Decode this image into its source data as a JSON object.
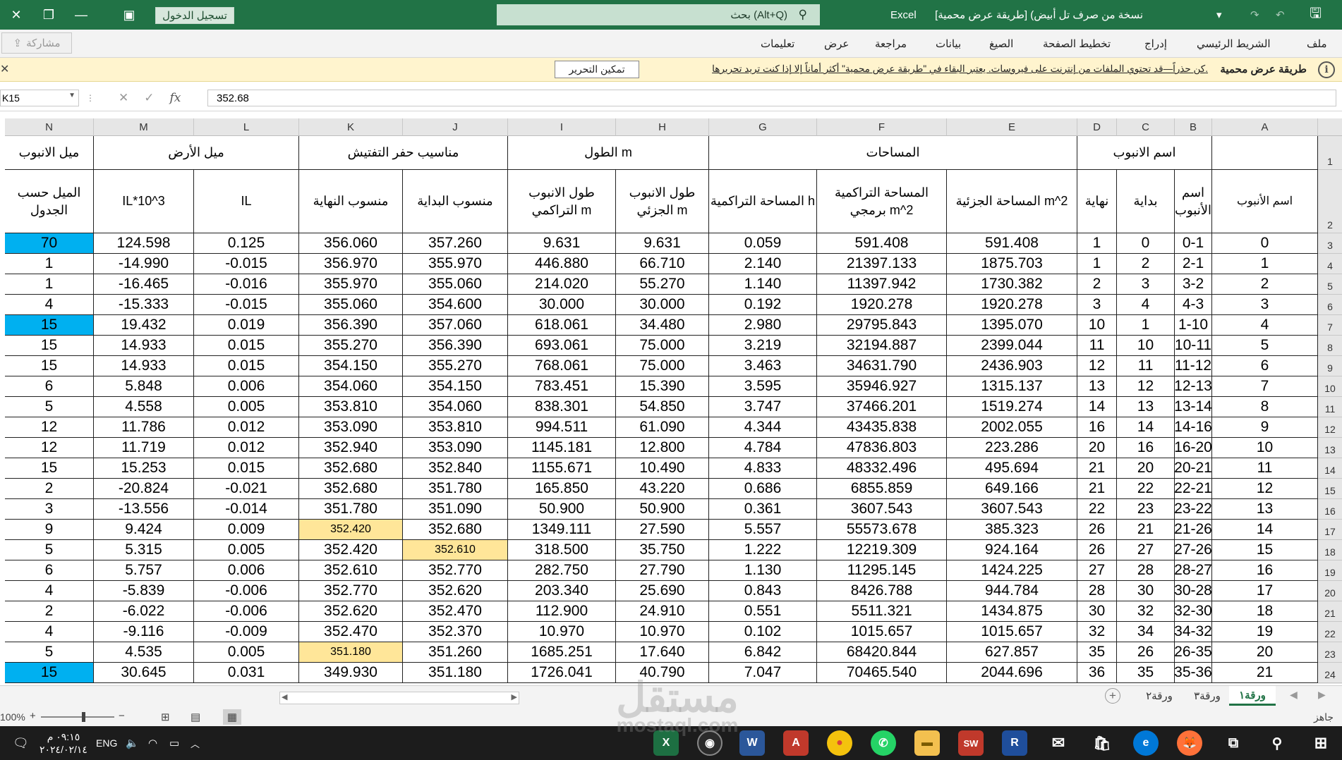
{
  "titlebar": {
    "app": "Excel",
    "document": "نسخة من صرف تل أبيض) [طريقة عرض محمية]",
    "search_placeholder": "بحث (Alt+Q)",
    "signin_label": "تسجيل الدخول"
  },
  "ribbon": {
    "tabs": [
      "ملف",
      "الشريط الرئيسي",
      "إدراج",
      "تخطيط الصفحة",
      "الصيغ",
      "بيانات",
      "مراجعة",
      "عرض",
      "تعليمات"
    ],
    "share_label": "مشاركة"
  },
  "protected_view": {
    "title": "طريقة عرض محمية",
    "message": "كن حذراً—قد تحتوي الملفات من إنترنت على فيروسات. يعتبر البقاء في \"طريقة عرض محمية\" أكثر أماناً إلا إذا كنت تريد تحريرها.",
    "enable_button": "تمكين التحرير"
  },
  "formula_bar": {
    "name_box": "K15",
    "cancel": "✕",
    "enter": "✓",
    "fx": "fx",
    "value": "352.68"
  },
  "columns": [
    "A",
    "B",
    "C",
    "D",
    "E",
    "F",
    "G",
    "H",
    "I",
    "J",
    "K",
    "L",
    "M",
    "N"
  ],
  "row_numbers": [
    "1",
    "2",
    "3",
    "4",
    "5",
    "6",
    "7",
    "8",
    "9",
    "10",
    "11",
    "12",
    "13",
    "14",
    "15",
    "16",
    "17",
    "18",
    "19",
    "20",
    "21",
    "22",
    "23",
    "24"
  ],
  "header_row1": {
    "pipe_name": "اسم الانبوب",
    "areas": "المساحات",
    "length": "الطول m",
    "inspection_levels": "مناسيب حفر التفتيش",
    "ground_slope": "ميل الأرض",
    "pipe_slope": "ميل الانبوب"
  },
  "header_row2": {
    "A": "اسم الأنبوب",
    "B": "اسم الأنبوب",
    "C": "بداية",
    "D": "نهاية",
    "E": "المساحة الجزئية m^2",
    "F": "المساحة التراكمية برمجي m^2",
    "G": "المساحة التراكمية h",
    "H": "طول الانبوب الجزئي m",
    "I": "طول الانبوب التراكمي m",
    "J": "منسوب البداية",
    "K": "منسوب النهاية",
    "L": "IL",
    "M": "IL*10^3",
    "N": "الميل حسب الجدول"
  },
  "rows": [
    [
      "0",
      "0-1",
      "0",
      "1",
      "591.408",
      "591.408",
      "0.059",
      "9.631",
      "9.631",
      "357.260",
      "356.060",
      "0.125",
      "124.598",
      "70"
    ],
    [
      "1",
      "2-1",
      "2",
      "1",
      "1875.703",
      "21397.133",
      "2.140",
      "66.710",
      "446.880",
      "355.970",
      "356.970",
      "-0.015",
      "-14.990",
      "1"
    ],
    [
      "2",
      "3-2",
      "3",
      "2",
      "1730.382",
      "11397.942",
      "1.140",
      "55.270",
      "214.020",
      "355.060",
      "355.970",
      "-0.016",
      "-16.465",
      "1"
    ],
    [
      "3",
      "4-3",
      "4",
      "3",
      "1920.278",
      "1920.278",
      "0.192",
      "30.000",
      "30.000",
      "354.600",
      "355.060",
      "-0.015",
      "-15.333",
      "4"
    ],
    [
      "4",
      "1-10",
      "1",
      "10",
      "1395.070",
      "29795.843",
      "2.980",
      "34.480",
      "618.061",
      "357.060",
      "356.390",
      "0.019",
      "19.432",
      "15"
    ],
    [
      "5",
      "10-11",
      "10",
      "11",
      "2399.044",
      "32194.887",
      "3.219",
      "75.000",
      "693.061",
      "356.390",
      "355.270",
      "0.015",
      "14.933",
      "15"
    ],
    [
      "6",
      "11-12",
      "11",
      "12",
      "2436.903",
      "34631.790",
      "3.463",
      "75.000",
      "768.061",
      "355.270",
      "354.150",
      "0.015",
      "14.933",
      "15"
    ],
    [
      "7",
      "12-13",
      "12",
      "13",
      "1315.137",
      "35946.927",
      "3.595",
      "15.390",
      "783.451",
      "354.150",
      "354.060",
      "0.006",
      "5.848",
      "6"
    ],
    [
      "8",
      "13-14",
      "13",
      "14",
      "1519.274",
      "37466.201",
      "3.747",
      "54.850",
      "838.301",
      "354.060",
      "353.810",
      "0.005",
      "4.558",
      "5"
    ],
    [
      "9",
      "14-16",
      "14",
      "16",
      "2002.055",
      "43435.838",
      "4.344",
      "61.090",
      "994.511",
      "353.810",
      "353.090",
      "0.012",
      "11.786",
      "12"
    ],
    [
      "10",
      "16-20",
      "16",
      "20",
      "223.286",
      "47836.803",
      "4.784",
      "12.800",
      "1145.181",
      "353.090",
      "352.940",
      "0.012",
      "11.719",
      "12"
    ],
    [
      "11",
      "20-21",
      "20",
      "21",
      "495.694",
      "48332.496",
      "4.833",
      "10.490",
      "1155.671",
      "352.840",
      "352.680",
      "0.015",
      "15.253",
      "15"
    ],
    [
      "12",
      "22-21",
      "22",
      "21",
      "649.166",
      "6855.859",
      "0.686",
      "43.220",
      "165.850",
      "351.780",
      "352.680",
      "-0.021",
      "-20.824",
      "2"
    ],
    [
      "13",
      "23-22",
      "23",
      "22",
      "3607.543",
      "3607.543",
      "0.361",
      "50.900",
      "50.900",
      "351.090",
      "351.780",
      "-0.014",
      "-13.556",
      "3"
    ],
    [
      "14",
      "21-26",
      "21",
      "26",
      "385.323",
      "55573.678",
      "5.557",
      "27.590",
      "1349.111",
      "352.680",
      "352.420",
      "0.009",
      "9.424",
      "9"
    ],
    [
      "15",
      "27-26",
      "27",
      "26",
      "924.164",
      "12219.309",
      "1.222",
      "35.750",
      "318.500",
      "352.610",
      "352.420",
      "0.005",
      "5.315",
      "5"
    ],
    [
      "16",
      "28-27",
      "28",
      "27",
      "1424.225",
      "11295.145",
      "1.130",
      "27.790",
      "282.750",
      "352.770",
      "352.610",
      "0.006",
      "5.757",
      "6"
    ],
    [
      "17",
      "30-28",
      "30",
      "28",
      "944.784",
      "8426.788",
      "0.843",
      "25.690",
      "203.340",
      "352.620",
      "352.770",
      "-0.006",
      "-5.839",
      "4"
    ],
    [
      "18",
      "32-30",
      "32",
      "30",
      "1434.875",
      "5511.321",
      "0.551",
      "24.910",
      "112.900",
      "352.470",
      "352.620",
      "-0.006",
      "-6.022",
      "2"
    ],
    [
      "19",
      "34-32",
      "34",
      "32",
      "1015.657",
      "1015.657",
      "0.102",
      "10.970",
      "10.970",
      "352.370",
      "352.470",
      "-0.009",
      "-9.116",
      "4"
    ],
    [
      "20",
      "26-35",
      "26",
      "35",
      "627.857",
      "68420.844",
      "6.842",
      "17.640",
      "1685.251",
      "351.260",
      "351.180",
      "0.005",
      "4.535",
      "5"
    ],
    [
      "21",
      "35-36",
      "35",
      "36",
      "2044.696",
      "70465.540",
      "7.047",
      "40.790",
      "1726.041",
      "351.180",
      "349.930",
      "0.031",
      "30.645",
      "15"
    ]
  ],
  "highlight_colors": {
    "blue": "#00b0f0",
    "yellow": "#ffe699"
  },
  "sheet_tabs": [
    "ورقة١",
    "ورقة٣",
    "ورقة٢"
  ],
  "status": {
    "ready": "جاهز",
    "zoom": "100%"
  },
  "taskbar": {
    "time": "٠٩:١٥ م",
    "date": "٢٠٢٤/٠٢/١٤",
    "lang": "ENG"
  },
  "watermark": {
    "line1": "مستقل",
    "line2": "mostaql.com"
  }
}
